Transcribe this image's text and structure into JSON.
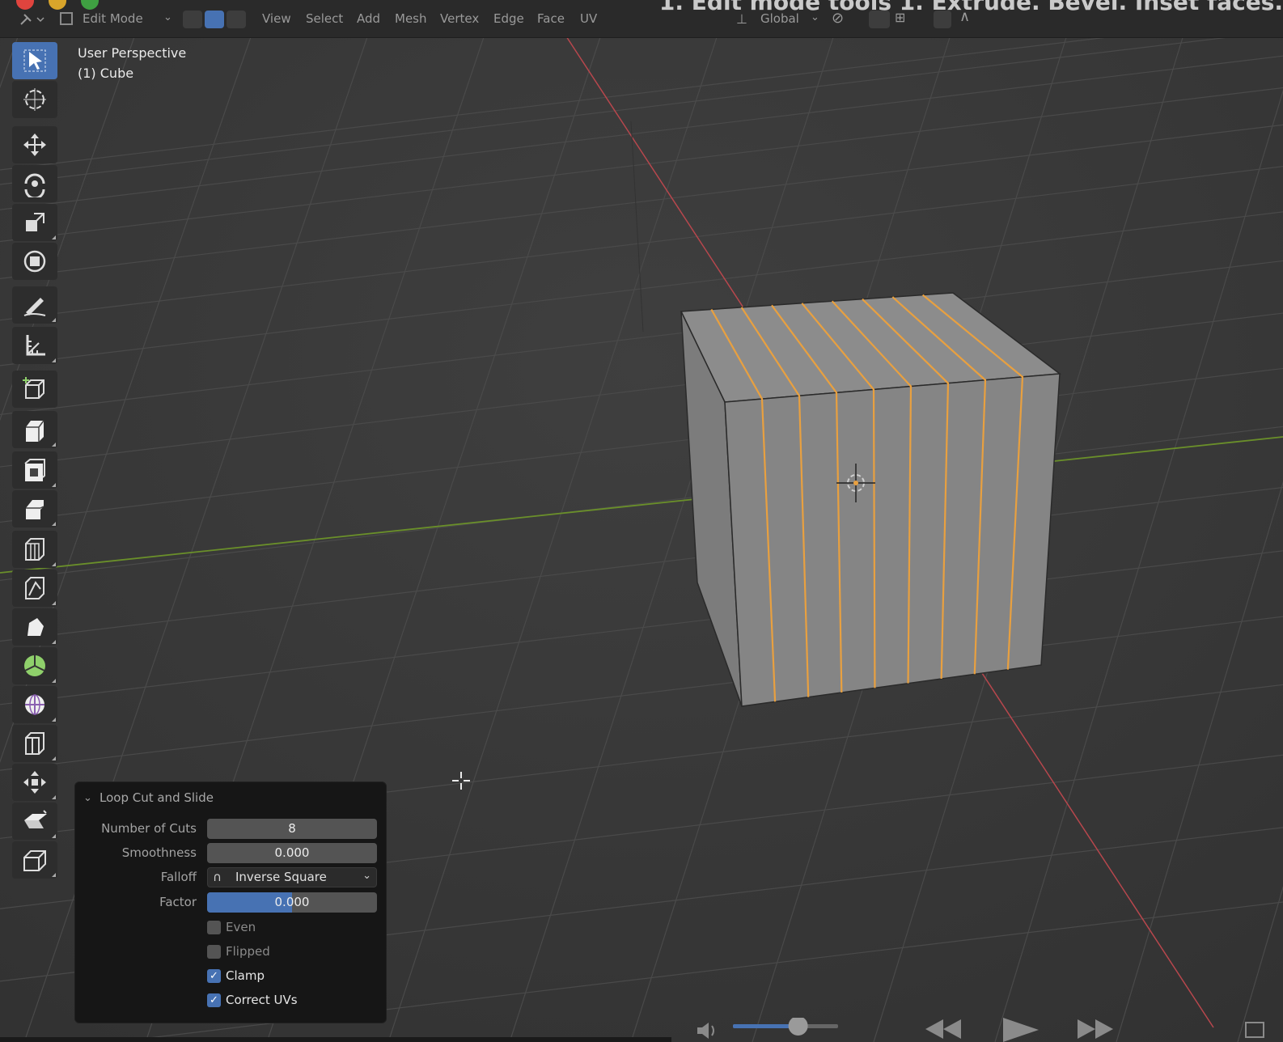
{
  "header": {
    "mode": "Edit Mode",
    "menus": [
      "View",
      "Select",
      "Add",
      "Mesh",
      "Vertex",
      "Edge",
      "Face",
      "UV"
    ],
    "transform_orientation": "Global",
    "video_title": "1. Edit mode tools 1. Extrude. Bevel. Inset faces."
  },
  "viewport": {
    "view_name": "User Perspective",
    "object_name": "(1) Cube"
  },
  "toolbar": {
    "tools": [
      "select-box",
      "cursor",
      "move",
      "rotate",
      "scale",
      "transform",
      "annotate",
      "measure",
      "add-cube",
      "extrude-region",
      "inset-faces",
      "bevel",
      "loop-cut",
      "knife",
      "poly-build",
      "spin",
      "smooth",
      "edge-slide",
      "shrink-fatten",
      "shear",
      "rip-region"
    ]
  },
  "operator_panel": {
    "title": "Loop Cut and Slide",
    "number_of_cuts_label": "Number of Cuts",
    "number_of_cuts": "8",
    "smoothness_label": "Smoothness",
    "smoothness": "0.000",
    "falloff_label": "Falloff",
    "falloff": "Inverse Square",
    "factor_label": "Factor",
    "factor": "0.000",
    "factor_fill": 0.5,
    "even_label": "Even",
    "even": false,
    "flipped_label": "Flipped",
    "flipped": false,
    "clamp_label": "Clamp",
    "clamp": true,
    "correct_uvs_label": "Correct UVs",
    "correct_uvs": true
  },
  "colors": {
    "accent": "#4772b3",
    "selected_edge": "#e8a040",
    "x_axis": "#b8474d",
    "y_axis": "#6a8f2a",
    "cube_face": "#8a8a8a"
  },
  "playback": {
    "progress": 0.62
  }
}
